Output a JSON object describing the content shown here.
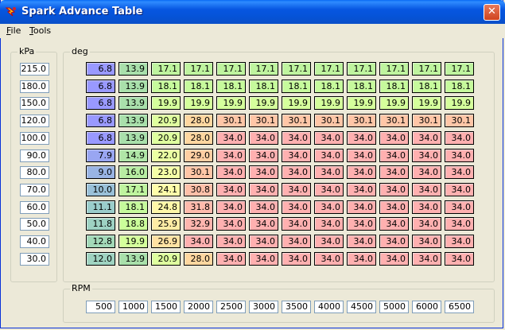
{
  "window": {
    "title": "Spark Advance Table",
    "close_glyph": "✕"
  },
  "menu": {
    "file": {
      "accel": "F",
      "rest": "ile"
    },
    "tools": {
      "accel": "T",
      "rest": "ools"
    }
  },
  "kpa_group": {
    "label": "kPa",
    "values": [
      "215.0",
      "180.0",
      "150.0",
      "120.0",
      "100.0",
      "90.0",
      "80.0",
      "70.0",
      "60.0",
      "50.0",
      "40.0",
      "30.0"
    ]
  },
  "deg_group": {
    "label": "deg",
    "rows": [
      [
        "6.8",
        "13.9",
        "17.1",
        "17.1",
        "17.1",
        "17.1",
        "17.1",
        "17.1",
        "17.1",
        "17.1",
        "17.1",
        "17.1"
      ],
      [
        "6.8",
        "13.9",
        "18.1",
        "18.1",
        "18.1",
        "18.1",
        "18.1",
        "18.1",
        "18.1",
        "18.1",
        "18.1",
        "18.1"
      ],
      [
        "6.8",
        "13.9",
        "19.9",
        "19.9",
        "19.9",
        "19.9",
        "19.9",
        "19.9",
        "19.9",
        "19.9",
        "19.9",
        "19.9"
      ],
      [
        "6.8",
        "13.9",
        "20.9",
        "28.0",
        "30.1",
        "30.1",
        "30.1",
        "30.1",
        "30.1",
        "30.1",
        "30.1",
        "30.1"
      ],
      [
        "6.8",
        "13.9",
        "20.9",
        "28.0",
        "34.0",
        "34.0",
        "34.0",
        "34.0",
        "34.0",
        "34.0",
        "34.0",
        "34.0"
      ],
      [
        "7.9",
        "14.9",
        "22.0",
        "29.0",
        "34.0",
        "34.0",
        "34.0",
        "34.0",
        "34.0",
        "34.0",
        "34.0",
        "34.0"
      ],
      [
        "9.0",
        "16.0",
        "23.0",
        "30.1",
        "34.0",
        "34.0",
        "34.0",
        "34.0",
        "34.0",
        "34.0",
        "34.0",
        "34.0"
      ],
      [
        "10.0",
        "17.1",
        "24.1",
        "30.8",
        "34.0",
        "34.0",
        "34.0",
        "34.0",
        "34.0",
        "34.0",
        "34.0",
        "34.0"
      ],
      [
        "11.1",
        "18.1",
        "24.8",
        "31.8",
        "34.0",
        "34.0",
        "34.0",
        "34.0",
        "34.0",
        "34.0",
        "34.0",
        "34.0"
      ],
      [
        "11.8",
        "18.8",
        "25.9",
        "32.9",
        "34.0",
        "34.0",
        "34.0",
        "34.0",
        "34.0",
        "34.0",
        "34.0",
        "34.0"
      ],
      [
        "12.8",
        "19.9",
        "26.9",
        "34.0",
        "34.0",
        "34.0",
        "34.0",
        "34.0",
        "34.0",
        "34.0",
        "34.0",
        "34.0"
      ],
      [
        "12.0",
        "13.9",
        "20.9",
        "28.0",
        "34.0",
        "34.0",
        "34.0",
        "34.0",
        "34.0",
        "34.0",
        "34.0",
        "34.0"
      ]
    ]
  },
  "rpm_group": {
    "label": "RPM",
    "values": [
      "500",
      "1000",
      "1500",
      "2000",
      "2500",
      "3000",
      "3500",
      "4000",
      "4500",
      "5000",
      "6000",
      "6500"
    ]
  },
  "colors": {
    "accent": "#0A56E0",
    "low": "#9999FF",
    "high": "#FFB0B0"
  }
}
